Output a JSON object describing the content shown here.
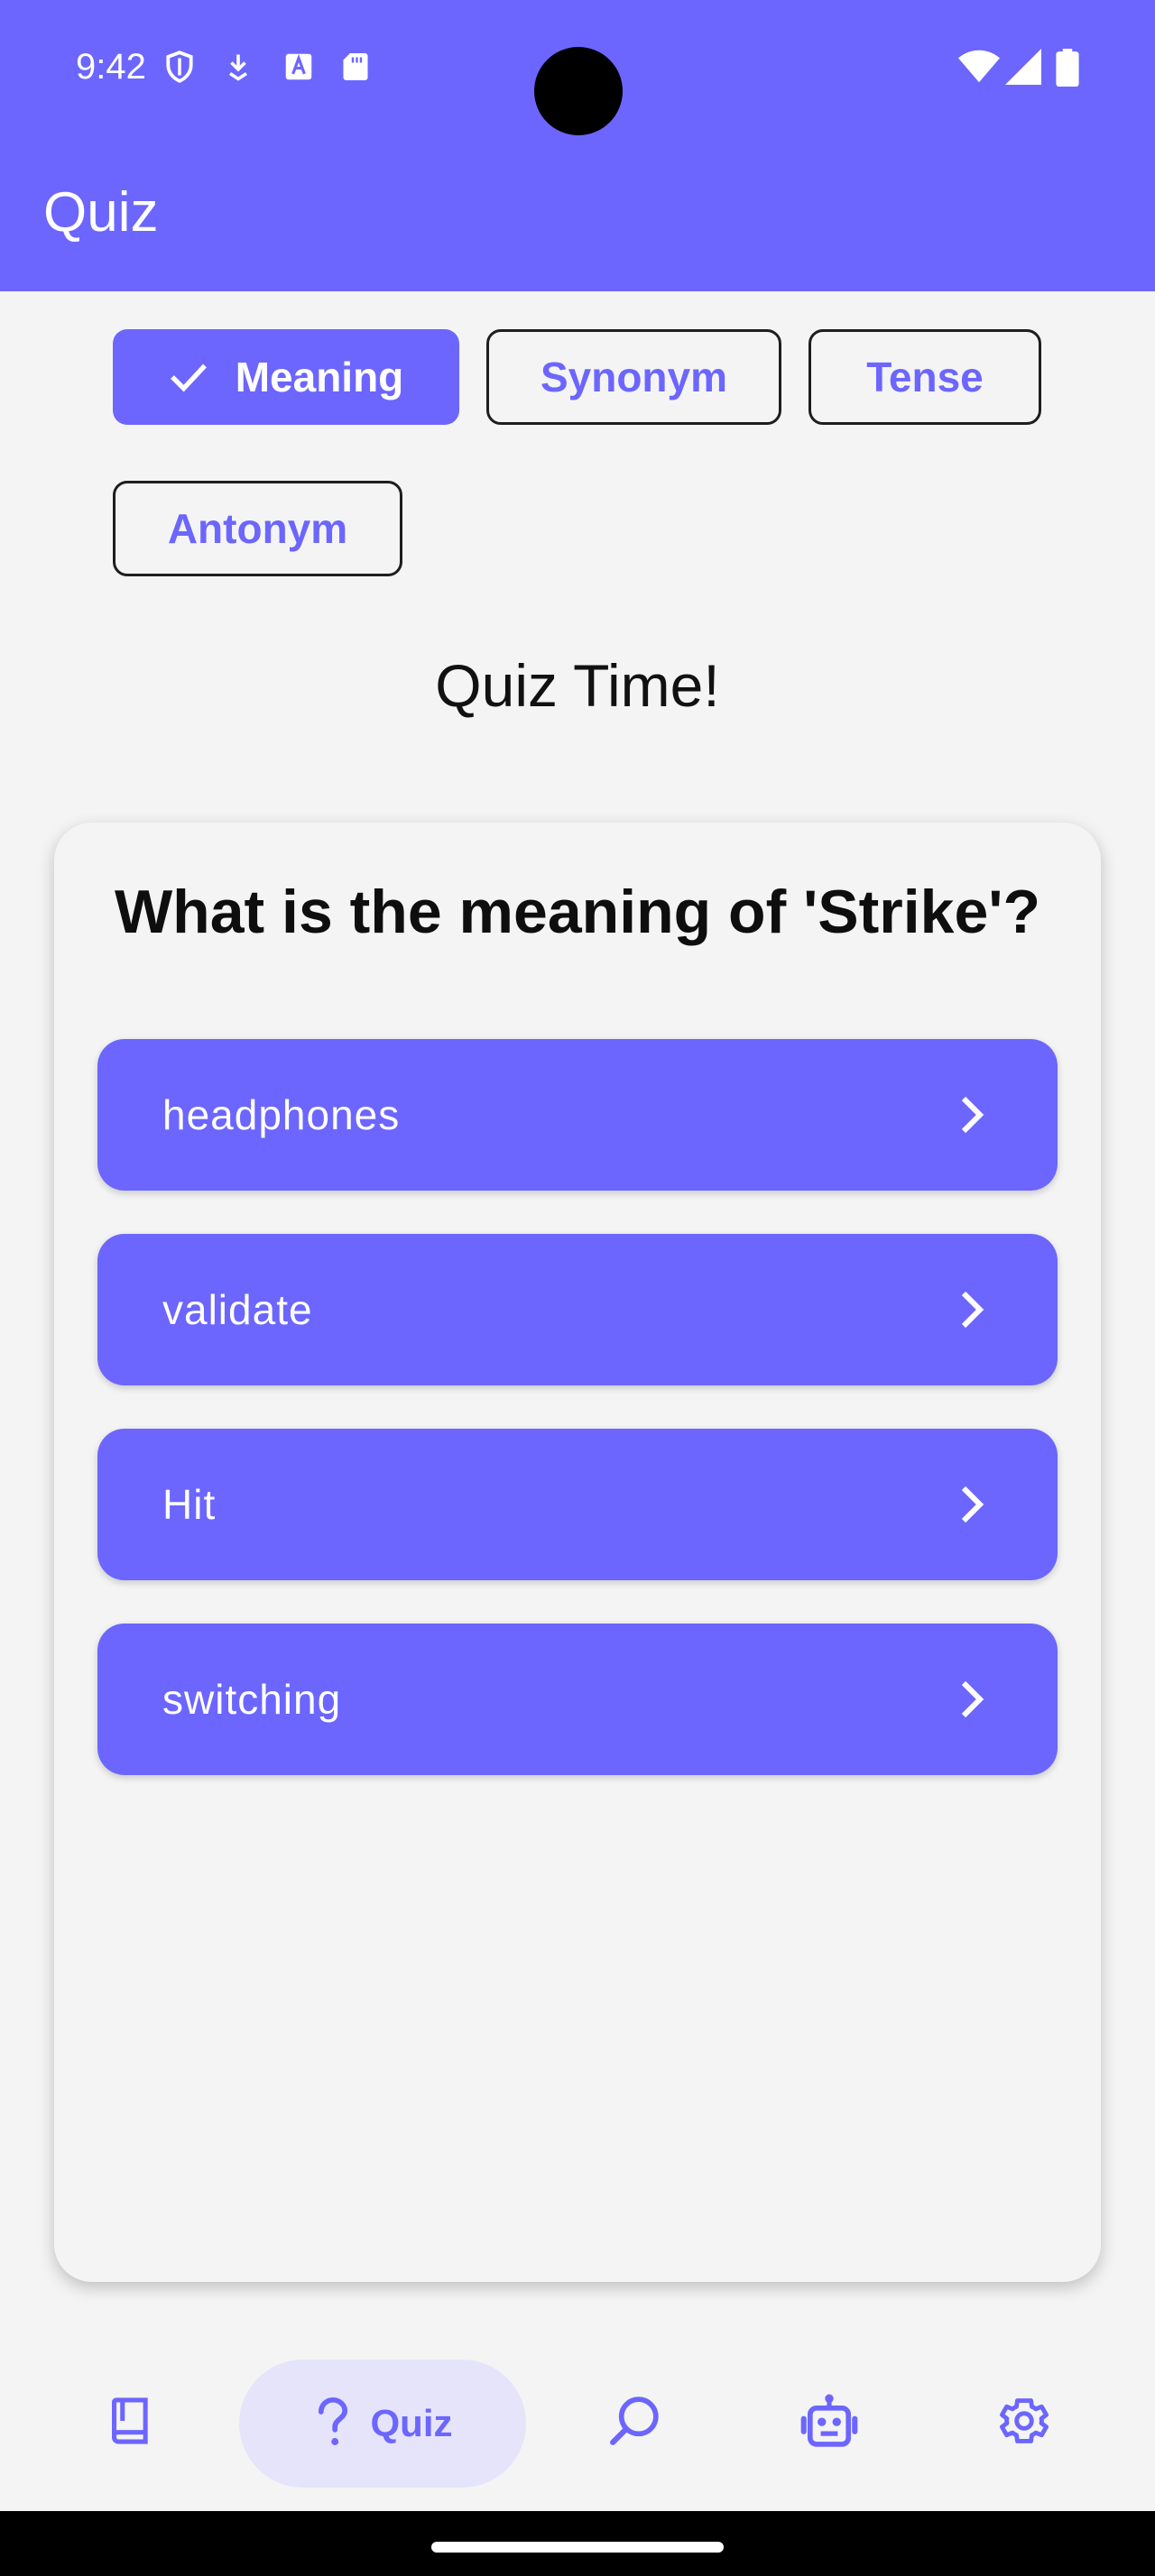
{
  "status_bar": {
    "time": "9:42"
  },
  "app_bar": {
    "title": "Quiz"
  },
  "filters": [
    {
      "label": "Meaning",
      "selected": true
    },
    {
      "label": "Synonym",
      "selected": false
    },
    {
      "label": "Tense",
      "selected": false
    },
    {
      "label": "Antonym",
      "selected": false
    }
  ],
  "heading": "Quiz Time!",
  "quiz": {
    "question": "What is the meaning of 'Strike'?",
    "options": [
      "headphones",
      "validate",
      "Hit",
      "switching"
    ]
  },
  "bottom_nav": {
    "items": [
      {
        "icon": "book-icon",
        "label": ""
      },
      {
        "icon": "quiz-icon",
        "label": "Quiz",
        "selected": true
      },
      {
        "icon": "search-icon",
        "label": ""
      },
      {
        "icon": "robot-icon",
        "label": ""
      },
      {
        "icon": "settings-icon",
        "label": ""
      }
    ]
  },
  "colors": {
    "primary": "#6c66fe",
    "background": "#f4f4f4",
    "nav_pill": "#e6e4fb"
  }
}
